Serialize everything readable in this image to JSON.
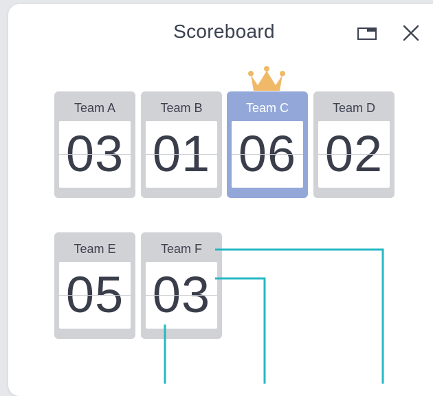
{
  "window": {
    "title": "Scoreboard",
    "restore_icon": "restore-window-icon",
    "close_icon": "close-icon"
  },
  "colors": {
    "card_bg": "#d1d2d6",
    "winner_bg": "#93a8d9",
    "crown": "#f0b968",
    "connector": "#25b8c4",
    "score_text": "#3a3e4b"
  },
  "teams": [
    {
      "name": "Team A",
      "score": "03"
    },
    {
      "name": "Team B",
      "score": "01"
    },
    {
      "name": "Team C",
      "score": "06",
      "leader": true
    },
    {
      "name": "Team D",
      "score": "02"
    },
    {
      "name": "Team E",
      "score": "05"
    },
    {
      "name": "Team F",
      "score": "03"
    }
  ]
}
